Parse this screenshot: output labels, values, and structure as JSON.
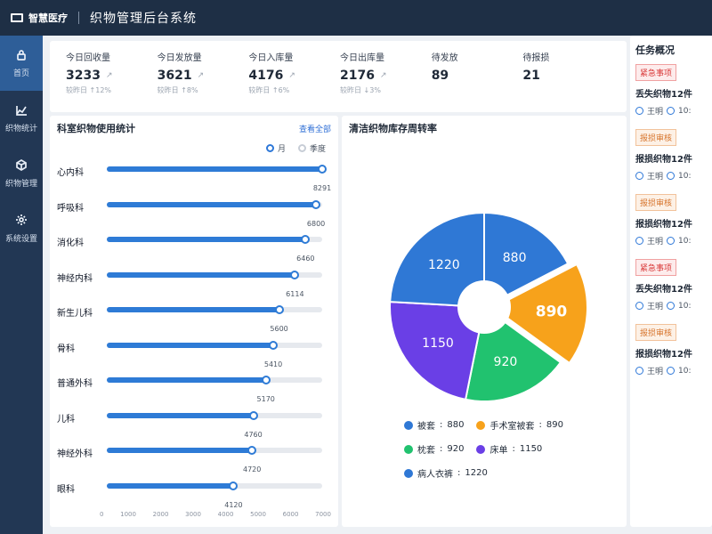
{
  "app": {
    "logo_text": "智慧医疗",
    "title": "织物管理后台系统"
  },
  "sidebar": {
    "items": [
      {
        "label": "首页",
        "icon": "lock-icon",
        "active": true
      },
      {
        "label": "织物统计",
        "icon": "chart-icon",
        "active": false
      },
      {
        "label": "织物管理",
        "icon": "box-icon",
        "active": false
      },
      {
        "label": "系统设置",
        "icon": "settings-icon",
        "active": false
      }
    ]
  },
  "stats": [
    {
      "label": "今日回收量",
      "value": "3233",
      "sub": "较昨日 ↑12%"
    },
    {
      "label": "今日发放量",
      "value": "3621",
      "sub": "较昨日 ↑8%"
    },
    {
      "label": "今日入库量",
      "value": "4176",
      "sub": "较昨日 ↑6%"
    },
    {
      "label": "今日出库量",
      "value": "2176",
      "sub": "较昨日 ↓3%"
    },
    {
      "label": "待发放",
      "value": "89",
      "sub": ""
    },
    {
      "label": "待报损",
      "value": "21",
      "sub": ""
    }
  ],
  "dept": {
    "title": "科室织物使用统计",
    "view_all": "查看全部",
    "toggles": [
      "月",
      "季度"
    ],
    "rows": [
      {
        "label": "心内科",
        "value": 8291,
        "display": "8291"
      },
      {
        "label": "呼吸科",
        "value": 6800,
        "display": "6800"
      },
      {
        "label": "消化科",
        "value": 6460,
        "display": "6460"
      },
      {
        "label": "神经内科",
        "value": 6114,
        "display": "6114"
      },
      {
        "label": "新生儿科",
        "value": 5600,
        "display": "5600"
      },
      {
        "label": "骨科",
        "value": 5410,
        "display": "5410"
      },
      {
        "label": "普通外科",
        "value": 5170,
        "display": "5170"
      },
      {
        "label": "儿科",
        "value": 4760,
        "display": "4760"
      },
      {
        "label": "神经外科",
        "value": 4720,
        "display": "4720"
      },
      {
        "label": "眼科",
        "value": 4120,
        "display": "4120"
      }
    ],
    "axis_ticks": [
      "0",
      "1000",
      "2000",
      "3000",
      "4000",
      "5000",
      "6000",
      "7000"
    ]
  },
  "pie": {
    "title": "清洁织物库存周转率",
    "slices": [
      {
        "label": "被套",
        "value": 880,
        "color": "#2f78d5"
      },
      {
        "label": "手术室被套",
        "value": 890,
        "color": "#f7a21b"
      },
      {
        "label": "枕套",
        "value": 920,
        "color": "#21c26f"
      },
      {
        "label": "床单",
        "value": 1150,
        "color": "#6a3fe6"
      },
      {
        "label": "病人衣裤",
        "value": 1220,
        "color": "#2f78d5"
      }
    ]
  },
  "tasks": {
    "title": "任务概况",
    "items": [
      {
        "tag": "紧急事项",
        "tag_type": "urgent",
        "name": "丢失织物12件",
        "user": "王明",
        "time": "10:"
      },
      {
        "tag": "报损审核",
        "tag_type": "normal",
        "name": "报损织物12件",
        "user": "王明",
        "time": "10:"
      },
      {
        "tag": "报损审核",
        "tag_type": "normal",
        "name": "报损织物12件",
        "user": "王明",
        "time": "10:"
      },
      {
        "tag": "紧急事项",
        "tag_type": "urgent",
        "name": "丢失织物12件",
        "user": "王明",
        "time": "10:"
      },
      {
        "tag": "报损审核",
        "tag_type": "normal",
        "name": "报损织物12件",
        "user": "王明",
        "time": "10:"
      }
    ]
  }
}
